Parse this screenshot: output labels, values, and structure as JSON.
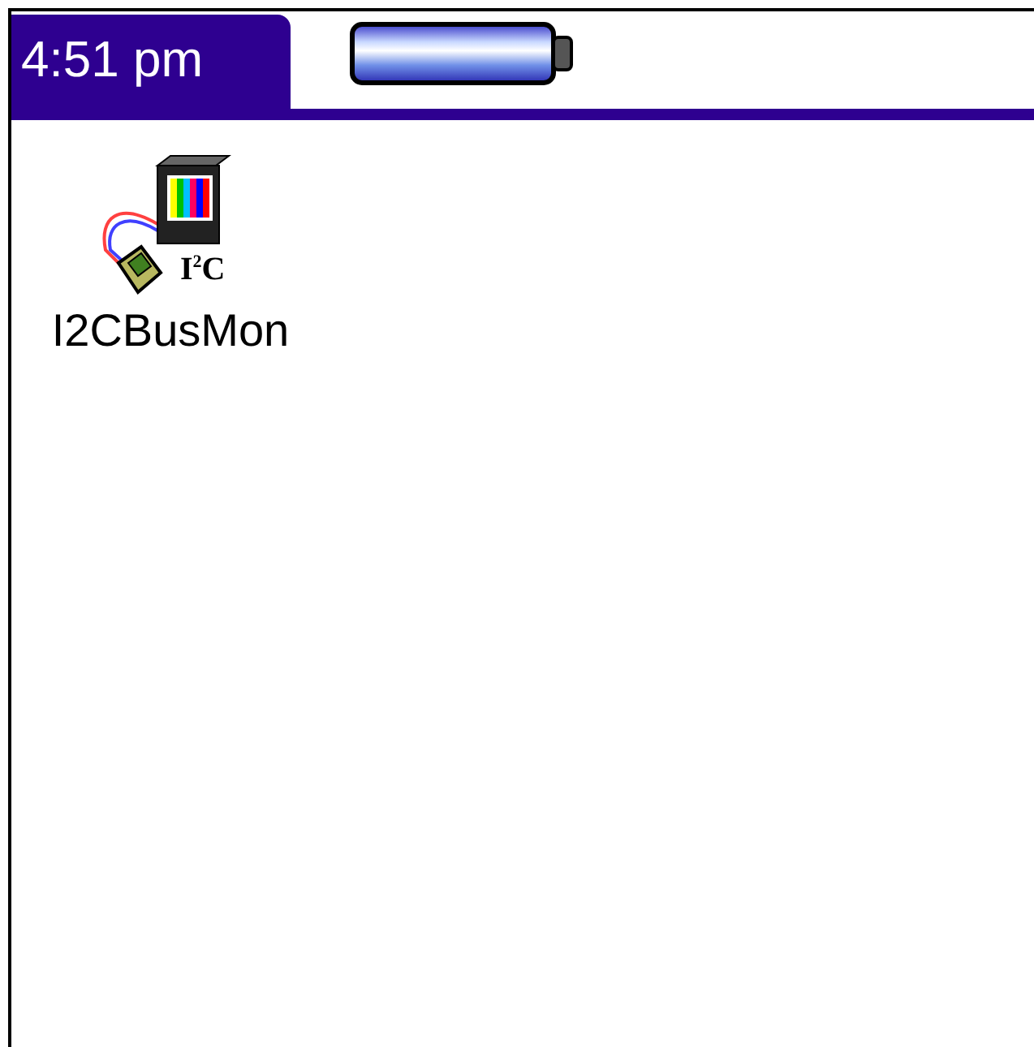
{
  "status_bar": {
    "time": "4:51 pm"
  },
  "apps": [
    {
      "name": "I2CBusMon",
      "icon_label": "I$^{2}$C"
    }
  ]
}
